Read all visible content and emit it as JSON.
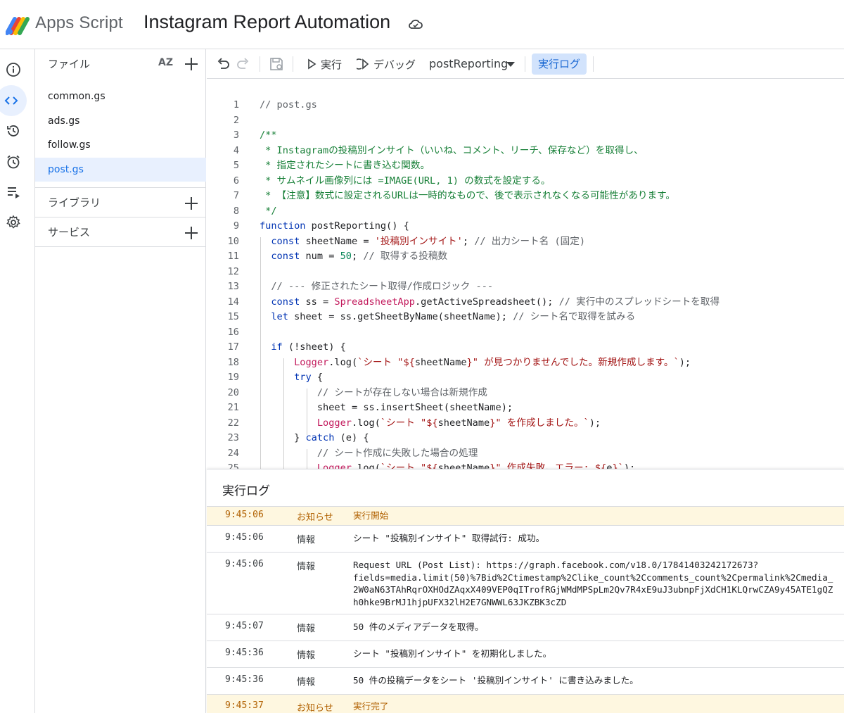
{
  "header": {
    "brand": "Apps Script",
    "project_title": "Instagram Report Automation"
  },
  "rail": {
    "items": [
      "overview",
      "editor",
      "executions",
      "triggers",
      "executions-list",
      "settings"
    ]
  },
  "files": {
    "title": "ファイル",
    "sort_label": "AZ",
    "items": [
      "common.gs",
      "ads.gs",
      "follow.gs",
      "post.gs"
    ],
    "selected": "post.gs",
    "libraries_label": "ライブラリ",
    "services_label": "サービス"
  },
  "toolbar": {
    "run_label": "実行",
    "debug_label": "デバッグ",
    "function_name": "postReporting",
    "log_label": "実行ログ"
  },
  "code": {
    "line_numbers": [
      "1",
      "2",
      "3",
      "4",
      "5",
      "6",
      "7",
      "8",
      "9",
      "10",
      "11",
      "12",
      "13",
      "14",
      "15",
      "16",
      "17",
      "18",
      "19",
      "20",
      "21",
      "22",
      "23",
      "24",
      "25"
    ]
  },
  "log": {
    "title": "実行ログ",
    "rows": [
      {
        "time": "9:45:06",
        "level": "お知らせ",
        "message": "実行開始",
        "type": "notice"
      },
      {
        "time": "9:45:06",
        "level": "情報",
        "message": "シート \"投稿別インサイト\" 取得試行: 成功。",
        "type": "info"
      },
      {
        "time": "9:45:06",
        "level": "情報",
        "message": "Request URL (Post List): https://graph.facebook.com/v18.0/17841403242172673?\nfields=media.limit(50)%7Bid%2Ctimestamp%2Clike_count%2Ccomments_count%2Cpermalink%2Cmedia_\n2W0aN63TAhRqrOXHOdZAqxX409VEP0qITrofRGjWMdMPSpLm2Qv7R4xE9uJ3ubnpFjXdCH1KLQrwCZA9y45ATE1gQZ\nh0hke9BrMJ1hjpUFX32lH2E7GNWWL63JKZBK3cZD",
        "type": "info"
      },
      {
        "time": "9:45:07",
        "level": "情報",
        "message": "50 件のメディアデータを取得。",
        "type": "info"
      },
      {
        "time": "9:45:36",
        "level": "情報",
        "message": "シート \"投稿別インサイト\" を初期化しました。",
        "type": "info"
      },
      {
        "time": "9:45:36",
        "level": "情報",
        "message": "50 件の投稿データをシート '投稿別インサイト' に書き込みました。",
        "type": "info"
      },
      {
        "time": "9:45:37",
        "level": "お知らせ",
        "message": "実行完了",
        "type": "notice"
      }
    ]
  },
  "colors": {
    "accent": "#1a73e8",
    "selected_bg": "#e8f0fe",
    "notice_bg": "#fef7e0",
    "comment_green": "#188038",
    "string_red": "#a31515"
  }
}
